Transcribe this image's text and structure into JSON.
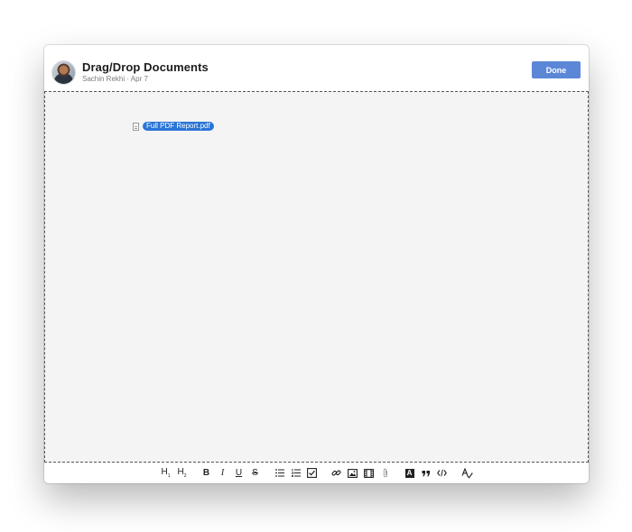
{
  "window": {
    "title": "Drag/Drop Documents",
    "meta": "Sachin Rekhi · Apr 7",
    "done_label": "Done"
  },
  "dropzone": {
    "attachment": "Full PDF Report.pdf"
  },
  "toolbar": {
    "items": [
      {
        "name": "heading-1",
        "glyph": "H1"
      },
      {
        "name": "heading-2",
        "glyph": "H2"
      },
      {
        "name": "bold",
        "glyph": "B"
      },
      {
        "name": "italic",
        "glyph": "I"
      },
      {
        "name": "underline",
        "glyph": "U"
      },
      {
        "name": "strikethrough",
        "glyph": "S"
      },
      {
        "name": "bullet-list",
        "glyph": "bullet-list-icon"
      },
      {
        "name": "numbered-list",
        "glyph": "numbered-list-icon"
      },
      {
        "name": "checklist",
        "glyph": "checkbox-icon"
      },
      {
        "name": "link",
        "glyph": "link-icon"
      },
      {
        "name": "image",
        "glyph": "image-icon"
      },
      {
        "name": "video",
        "glyph": "film-icon"
      },
      {
        "name": "attachment",
        "glyph": "paperclip-icon"
      },
      {
        "name": "text-highlight",
        "glyph": "A"
      },
      {
        "name": "quote",
        "glyph": "quote-icon"
      },
      {
        "name": "code",
        "glyph": "code-icon"
      },
      {
        "name": "spellcheck",
        "glyph": "spellcheck-icon"
      }
    ]
  },
  "colors": {
    "accent": "#5b87d6",
    "chip": "#2b75d6",
    "dropzone_bg": "#f4f4f4"
  }
}
